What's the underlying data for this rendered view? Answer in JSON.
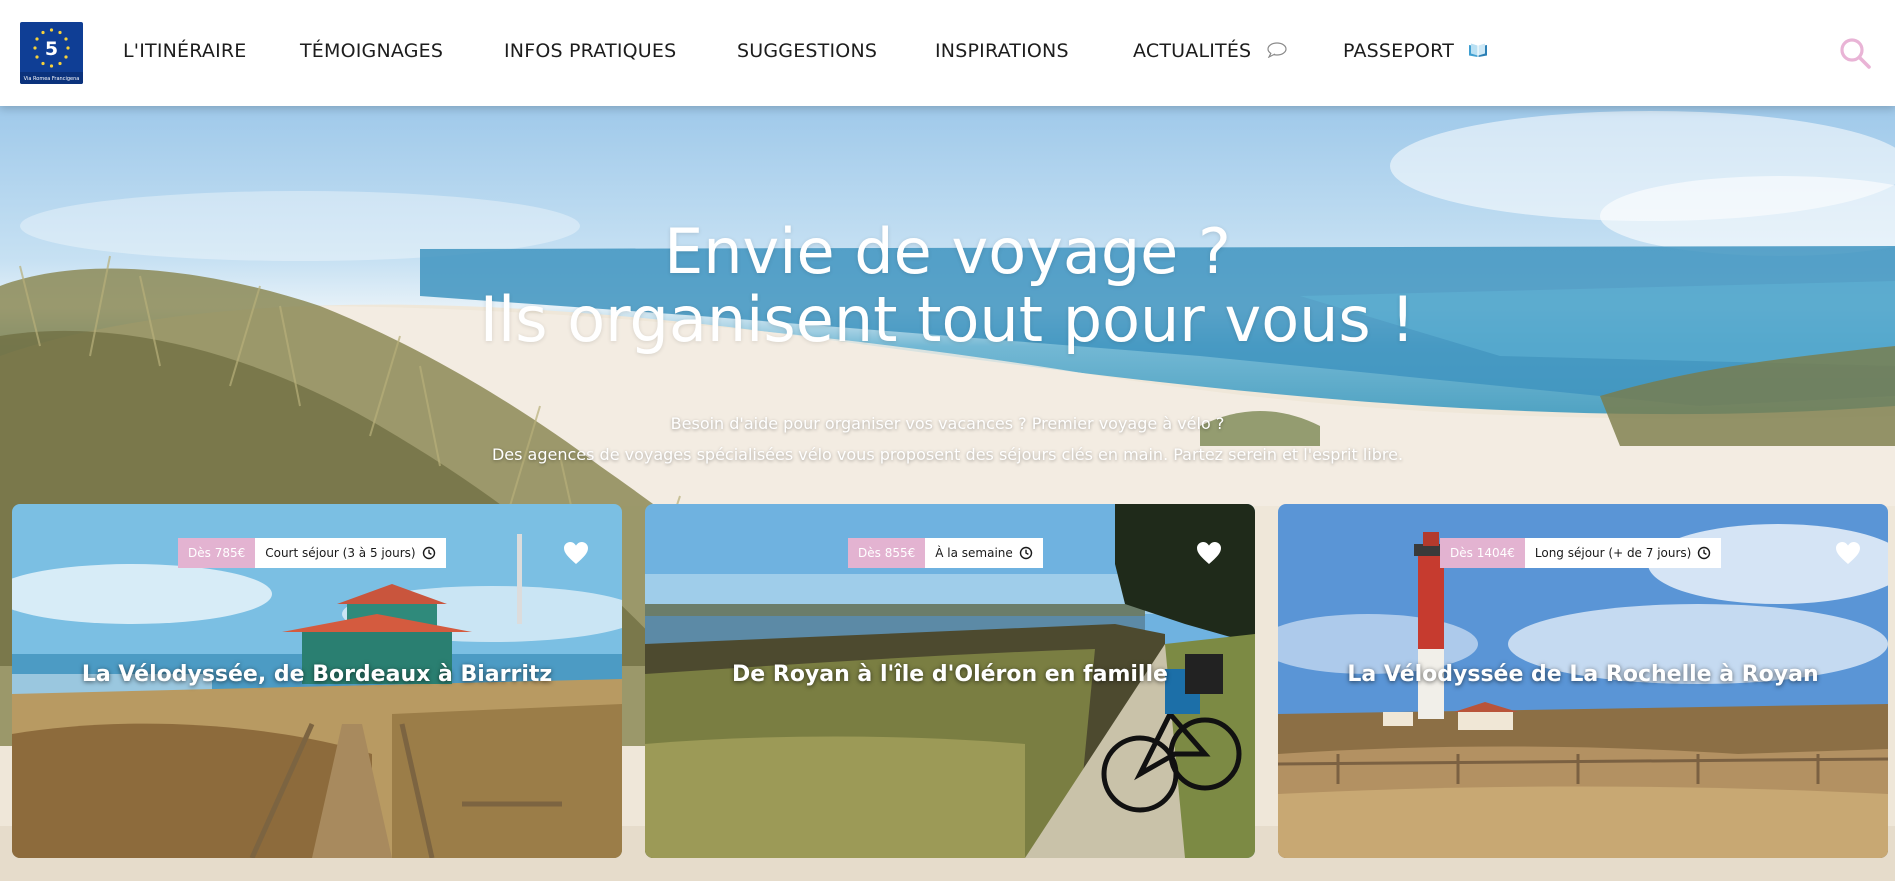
{
  "header": {
    "logo": {
      "number": "5",
      "caption": "Via Romea Francigena"
    },
    "nav": [
      {
        "label": "L'ITINÉRAIRE"
      },
      {
        "label": "TÉMOIGNAGES"
      },
      {
        "label": "INFOS PRATIQUES"
      },
      {
        "label": "SUGGESTIONS"
      },
      {
        "label": "INSPIRATIONS"
      },
      {
        "label": "ACTUALITÉS",
        "icon": "speech-bubble-icon"
      },
      {
        "label": "PASSEPORT",
        "icon": "open-book-icon"
      }
    ],
    "search_icon": "search-icon"
  },
  "hero": {
    "title_line1": "Envie de voyage ?",
    "title_line2": "Ils organisent tout pour vous !",
    "subtitle_line1": "Besoin d'aide pour organiser vos vacances ? Premier voyage à vélo ?",
    "subtitle_line2": "Des agences de voyages spécialisées vélo vous proposent des séjours clés en main. Partez serein et l'esprit libre."
  },
  "cards": [
    {
      "price": "Dès 785€",
      "duration": "Court séjour (3 à 5 jours)",
      "title": "La Vélodyssée, de Bordeaux à Biarritz",
      "icon": "heart-icon"
    },
    {
      "price": "Dès 855€",
      "duration": "À la semaine",
      "title": "De Royan à l'île d'Oléron en famille",
      "icon": "heart-icon"
    },
    {
      "price": "Dès 1404€",
      "duration": "Long séjour (+ de 7 jours)",
      "title": "La Vélodyssée de La Rochelle à Royan",
      "icon": "heart-icon"
    }
  ],
  "colors": {
    "accent_pink": "#e3b3d1",
    "logo_blue": "#0f3e95",
    "nav_text": "#1d1d1d"
  }
}
